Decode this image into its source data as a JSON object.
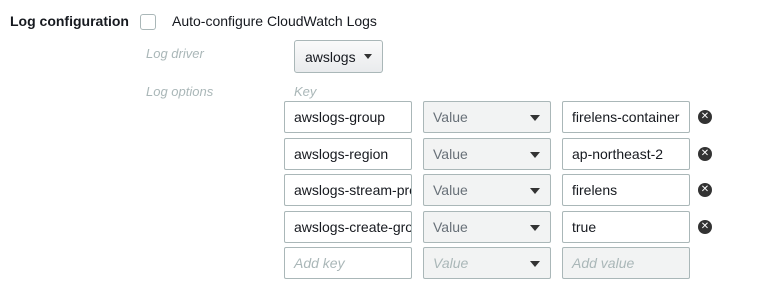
{
  "section": {
    "title": "Log configuration",
    "auto_configure_label": "Auto-configure CloudWatch Logs",
    "auto_configure_checked": false
  },
  "log_driver": {
    "label": "Log driver",
    "selected": "awslogs"
  },
  "log_options": {
    "label": "Log options",
    "key_header": "Key",
    "rows": [
      {
        "key": "awslogs-group",
        "type": "Value",
        "value": "firelens-container"
      },
      {
        "key": "awslogs-region",
        "type": "Value",
        "value": "ap-northeast-2"
      },
      {
        "key": "awslogs-stream-prefix",
        "type": "Value",
        "value": "firelens"
      },
      {
        "key": "awslogs-create-group",
        "type": "Value",
        "value": "true"
      }
    ],
    "new_row": {
      "key_placeholder": "Add key",
      "type_placeholder": "Value",
      "value_placeholder": "Add value"
    }
  },
  "icons": {
    "remove": "close-circle-icon",
    "dropdown": "caret-down-icon"
  },
  "colors": {
    "border": "#aab7b8",
    "muted_text": "#aab7b8",
    "disabled_bg": "#f2f3f3"
  }
}
